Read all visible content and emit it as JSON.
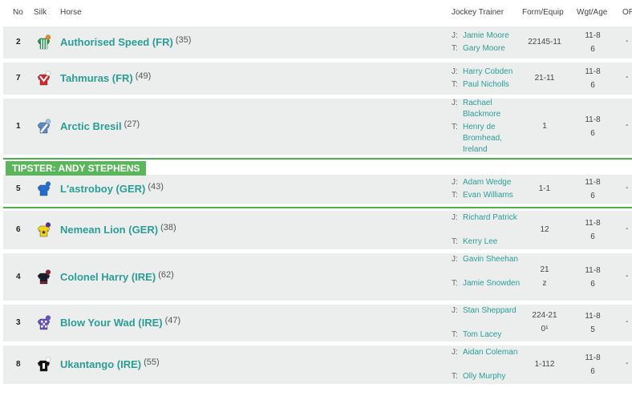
{
  "headers": {
    "no": "No",
    "silk": "Silk",
    "horse": "Horse",
    "jockey_trainer": "Jockey Trainer",
    "form": "Form/Equip",
    "wgt": "Wgt/Age",
    "or": "OR"
  },
  "jockey_label": "J:",
  "trainer_label": "T:",
  "tipster": "TIPSTER: ANDY STEPHENS",
  "runners": [
    {
      "no": "2",
      "horse": "Authorised Speed (FR)",
      "days": "(35)",
      "jockey": "Jamie Moore",
      "trainer": "Gary Moore",
      "form": "22145-11",
      "form2": "",
      "weight": "11-8",
      "age": "6",
      "or": "-",
      "silk": {
        "body": "#1e9c4a",
        "pattern": "stripes",
        "cap": "#e8891d"
      }
    },
    {
      "no": "7",
      "horse": "Tahmuras (FR)",
      "days": "(49)",
      "jockey": "Harry Cobden",
      "trainer": "Paul Nicholls",
      "form": "21-11",
      "form2": "",
      "weight": "11-8",
      "age": "6",
      "or": "-",
      "silk": {
        "body": "#d9252b",
        "pattern": "chevron",
        "cap": "#ffffff"
      }
    },
    {
      "no": "1",
      "horse": "Arctic Bresil",
      "days": "(27)",
      "jockey": "Rachael Blackmore",
      "trainer": "Henry de Bromhead, Ireland",
      "form": "1",
      "form2": "",
      "weight": "11-8",
      "age": "6",
      "or": "-",
      "silk": {
        "body": "#5b8ac7",
        "pattern": "sash",
        "cap": "#9bc0e8"
      }
    },
    {
      "no": "5",
      "horse": "L'astroboy (GER)",
      "days": "(43)",
      "jockey": "Adam Wedge",
      "trainer": "Evan Williams",
      "form": "1-1",
      "form2": "",
      "weight": "11-8",
      "age": "6",
      "or": "-",
      "silk": {
        "body": "#1f6fd1",
        "pattern": "plain",
        "cap": "#1f6fd1"
      }
    },
    {
      "no": "6",
      "horse": "Nemean Lion (GER)",
      "days": "(38)",
      "jockey": "Richard Patrick",
      "trainer": "Kerry Lee",
      "form": "12",
      "form2": "",
      "weight": "11-8",
      "age": "6",
      "or": "-",
      "silk": {
        "body": "#f2d21b",
        "pattern": "star",
        "cap": "#5a2d8c"
      }
    },
    {
      "no": "4",
      "horse": "Colonel Harry (IRE)",
      "days": "(62)",
      "jockey": "Gavin Sheehan",
      "trainer": "Jamie Snowden",
      "form": "21",
      "form2": "z",
      "weight": "11-8",
      "age": "6",
      "or": "-",
      "silk": {
        "body": "#1b1b2e",
        "pattern": "trim",
        "cap": "#8b1d2c"
      }
    },
    {
      "no": "3",
      "horse": "Blow Your Wad (IRE)",
      "days": "(47)",
      "jockey": "Stan Sheppard",
      "trainer": "Tom Lacey",
      "form": "224-21",
      "form2": "0¹",
      "weight": "11-8",
      "age": "5",
      "or": "-",
      "silk": {
        "body": "#6a4fc2",
        "pattern": "check",
        "cap": "#6a4fc2"
      }
    },
    {
      "no": "8",
      "horse": "Ukantango (IRE)",
      "days": "(55)",
      "jockey": "Aidan Coleman",
      "trainer": "Olly Murphy",
      "form": "1-112",
      "form2": "",
      "weight": "11-8",
      "age": "6",
      "or": "-",
      "silk": {
        "body": "#111111",
        "pattern": "panel",
        "cap": "#ffffff"
      }
    }
  ]
}
